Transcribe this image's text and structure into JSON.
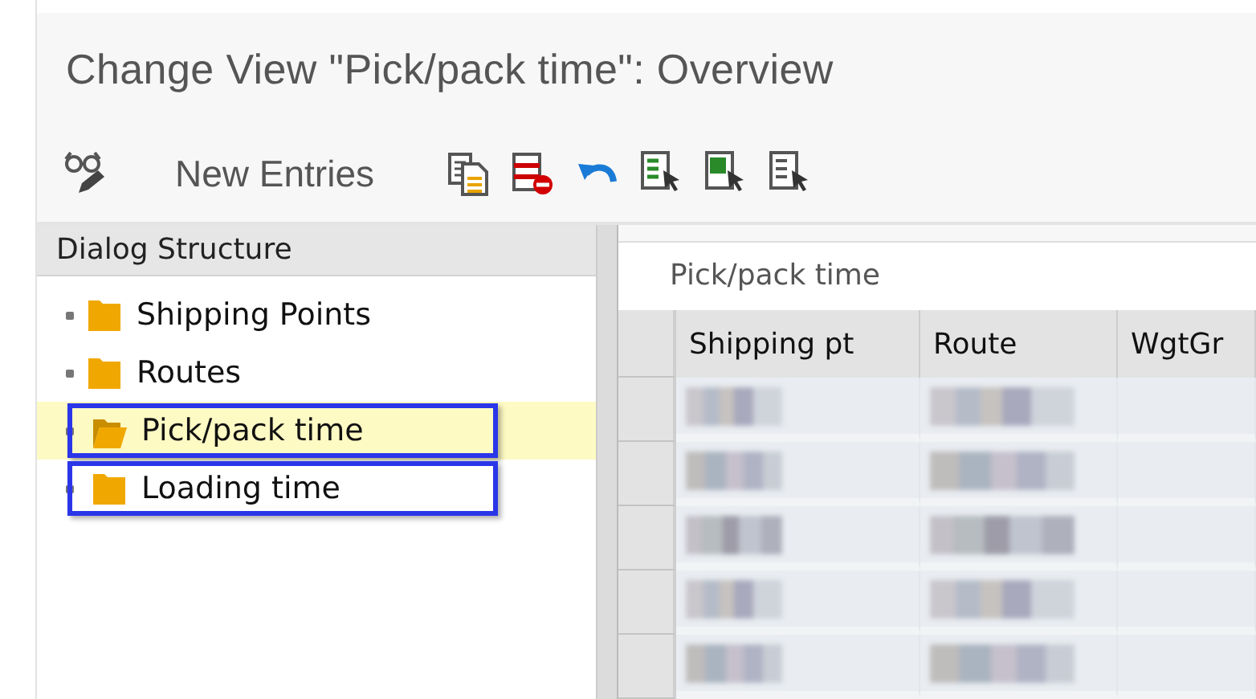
{
  "window": {
    "title": "Change View \"Pick/pack time\": Overview"
  },
  "toolbar": [
    {
      "kind": "display-change"
    },
    {
      "kind": "text",
      "label": "New Entries"
    },
    {
      "kind": "copy"
    },
    {
      "kind": "delete"
    },
    {
      "kind": "undo"
    },
    {
      "kind": "select-all"
    },
    {
      "kind": "select-block"
    },
    {
      "kind": "deselect-all"
    }
  ],
  "dialog_structure": {
    "title": "Dialog Structure",
    "items": [
      {
        "label": "Shipping Points",
        "selected": false,
        "outlined": false
      },
      {
        "label": "Routes",
        "selected": false,
        "outlined": false
      },
      {
        "label": "Pick/pack time",
        "selected": true,
        "outlined": true
      },
      {
        "label": "Loading time",
        "selected": false,
        "outlined": true
      }
    ]
  },
  "table": {
    "title": "Pick/pack time",
    "columns": [
      "Shipping pt",
      "Route",
      "WgtGr"
    ],
    "rows": [
      {
        "blurred": true
      },
      {
        "blurred": true
      },
      {
        "blurred": true
      },
      {
        "blurred": true
      },
      {
        "blurred": true
      }
    ]
  }
}
